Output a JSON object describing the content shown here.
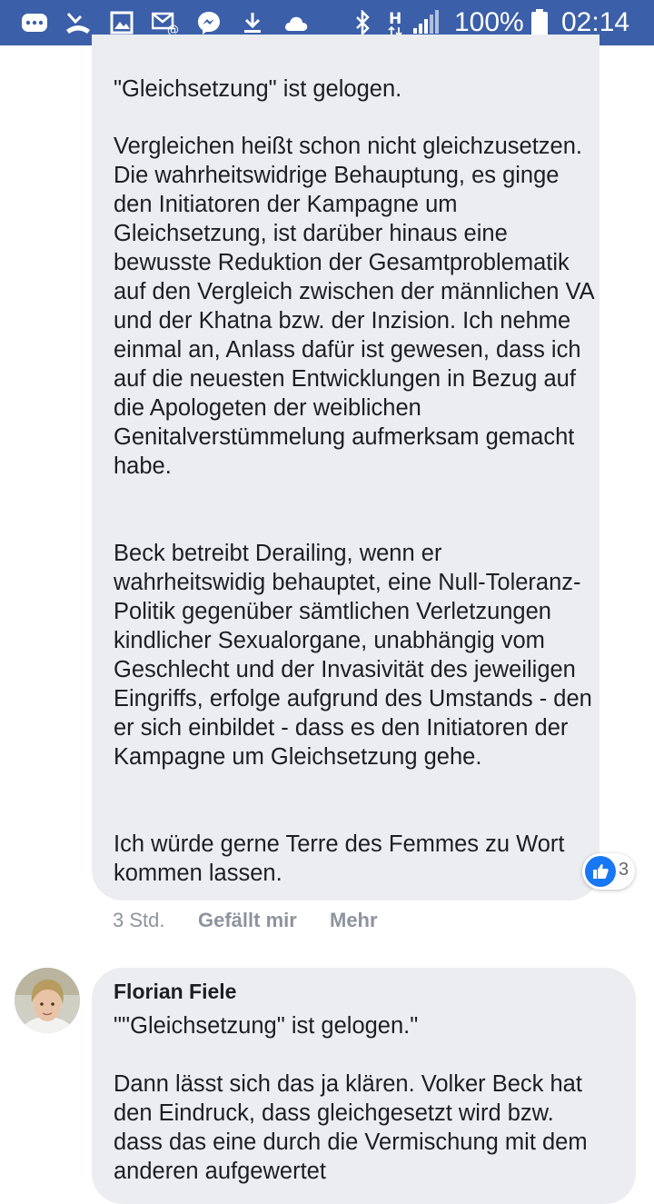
{
  "status_bar": {
    "icons_left": [
      "chat-icon",
      "missed-call-icon",
      "image-icon",
      "email-icon",
      "messenger-icon",
      "download-icon",
      "cloud-icon"
    ],
    "icons_right": [
      "bluetooth-icon",
      "hspa-icon",
      "signal-icon",
      "battery-icon"
    ],
    "network_type": "H",
    "battery_percent": "100%",
    "time": "02:14",
    "bar_color": "#3b5fa8"
  },
  "comment1": {
    "paragraphs": [
      "\"Gleichsetzung\" ist gelogen.",
      "Vergleichen heißt schon nicht gleichzusetzen. Die wahrheitswidrige Behauptung, es ginge den Initiatoren der Kampagne um Gleichsetzung, ist darüber hinaus eine bewusste Reduktion der Gesamtproblematik auf den Vergleich zwischen der männlichen VA und der Khatna bzw. der Inzision. Ich nehme einmal an, Anlass dafür ist gewesen, dass ich auf die neuesten Entwicklungen in Bezug auf die Apologeten der weiblichen Genitalverstümmelung aufmerksam gemacht habe.",
      "Beck betreibt Derailing, wenn er wahrheitswidig behauptet, eine Null-Toleranz-Politik gegenüber sämtlichen Verletzungen kindlicher Sexualorgane, unabhängig vom Geschlecht und der Invasivität des jeweiligen Eingriffs, erfolge aufgrund des Umstands - den er sich einbildet - dass es den Initiatoren der Kampagne um Gleichsetzung gehe.",
      "Ich würde gerne Terre des Femmes zu Wort kommen lassen."
    ],
    "reaction_count": "3",
    "time": "3 Std.",
    "like_label": "Gefällt mir",
    "more_label": "Mehr"
  },
  "comment2": {
    "author": "Florian Fiele",
    "paragraphs": [
      "\"\"Gleichsetzung\" ist gelogen.\"",
      "Dann lässt sich das ja klären. Volker Beck hat den Eindruck, dass gleichgesetzt wird bzw. dass das eine durch die Vermischung mit dem anderen aufgewertet"
    ]
  },
  "colors": {
    "bubble_bg": "#ebedf0",
    "text": "#1c1e21",
    "meta_text": "#8d949e",
    "like_blue": "#1877f2"
  }
}
